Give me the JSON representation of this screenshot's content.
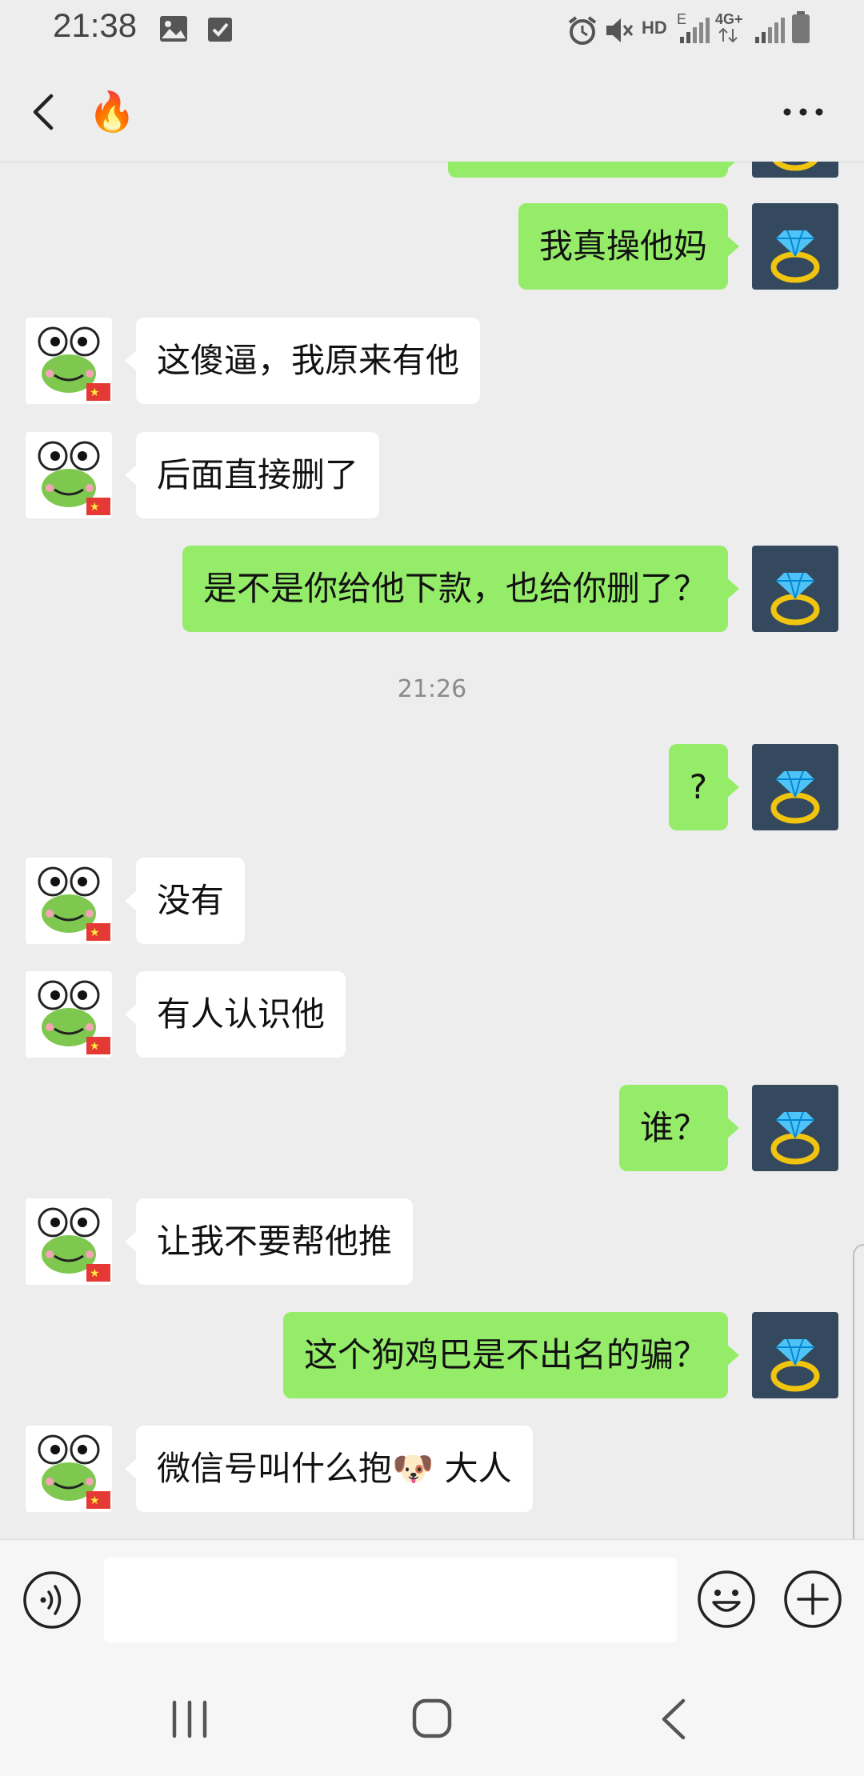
{
  "status_bar": {
    "time": "21:38",
    "hd_label": "HD",
    "network_label": "4G+",
    "e_label": "E",
    "icons": [
      "image-icon",
      "check-square-icon",
      "alarm-icon",
      "mute-icon",
      "hd-icon",
      "signal-icon",
      "4g-signal-icon",
      "battery-icon"
    ]
  },
  "header": {
    "back_icon": "chevron-left-icon",
    "title_emoji": "🔥",
    "more_icon": "more-dots-icon"
  },
  "messages": [
    {
      "side": "me",
      "text": "我真操他妈",
      "avatar": "ring-avatar"
    },
    {
      "side": "them",
      "text": "这傻逼，我原来有他",
      "avatar": "frog-avatar"
    },
    {
      "side": "them",
      "text": "后面直接删了",
      "avatar": "frog-avatar"
    },
    {
      "side": "me",
      "text": "是不是你给他下款，也给你删了？",
      "avatar": "ring-avatar"
    },
    {
      "type": "timestamp",
      "text": "21:26"
    },
    {
      "side": "me",
      "text": "?",
      "avatar": "ring-avatar"
    },
    {
      "side": "them",
      "text": "没有",
      "avatar": "frog-avatar"
    },
    {
      "side": "them",
      "text": "有人认识他",
      "avatar": "frog-avatar"
    },
    {
      "side": "me",
      "text": "谁？",
      "avatar": "ring-avatar"
    },
    {
      "side": "them",
      "text": "让我不要帮他推",
      "avatar": "frog-avatar"
    },
    {
      "side": "me",
      "text": "这个狗鸡巴是不出名的骗？",
      "avatar": "ring-avatar"
    },
    {
      "side": "them",
      "text": "微信号叫什么抱🐶 大人",
      "avatar": "frog-avatar"
    }
  ],
  "input_bar": {
    "input_value": "",
    "icons": [
      "voice-icon",
      "emoji-icon",
      "plus-icon"
    ]
  },
  "nav_bar": {
    "icons": [
      "recent-apps-icon",
      "home-icon",
      "back-icon"
    ]
  },
  "colors": {
    "background": "#ededed",
    "my_bubble": "#95ec69",
    "their_bubble": "#ffffff",
    "ring_avatar_bg": "#34495e"
  }
}
